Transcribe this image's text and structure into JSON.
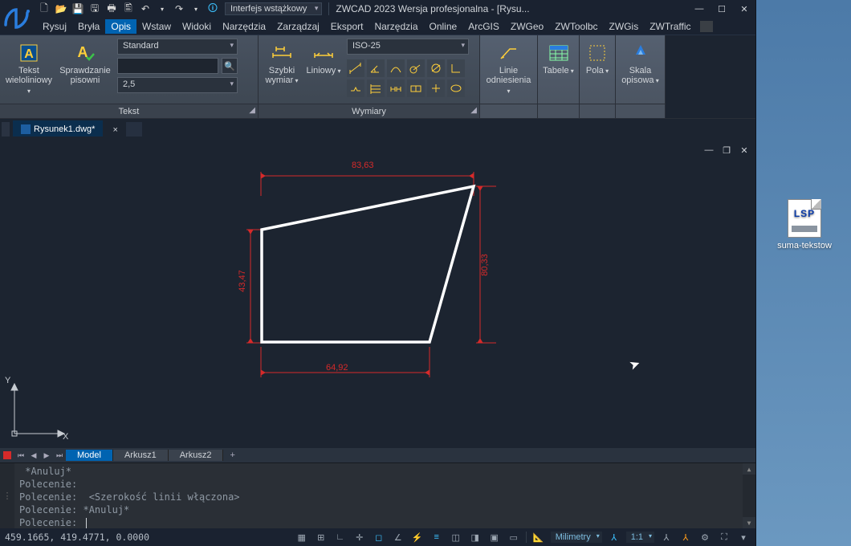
{
  "title": "ZWCAD 2023 Wersja profesjonalna - [Rysu...",
  "ribbon_mode": "Interfejs wstążkowy",
  "menus": [
    "Rysuj",
    "Bryła",
    "Opis",
    "Wstaw",
    "Widoki",
    "Narzędzia",
    "Zarządzaj",
    "Eksport",
    "Narzędzia",
    "Online",
    "ArcGIS",
    "ZWGeo",
    "ZWToolbc",
    "ZWGis",
    "ZWTraffic"
  ],
  "active_menu": 2,
  "ribbon": {
    "text_panel": {
      "caption": "Tekst",
      "mtext": "Tekst\nwieloliniowy",
      "spell": "Sprawdzanie\npisowni",
      "style": "Standard",
      "height": "2,5"
    },
    "dim_panel": {
      "caption": "Wymiary",
      "quick": "Szybki\nwymiar",
      "linear": "Liniowy",
      "style": "ISO-25"
    },
    "leaders": "Linie\nodniesienia",
    "tables": "Tabele",
    "fields": "Pola",
    "scale": "Skala\nopisowa"
  },
  "file_tab": "Rysunek1.dwg*",
  "sheet_tabs": {
    "model": "Model",
    "sheets": [
      "Arkusz1",
      "Arkusz2"
    ]
  },
  "dims": {
    "top": "83,63",
    "right": "80,33",
    "left": "43,47",
    "bottom": "64,92"
  },
  "ucs": {
    "x": "X",
    "y": "Y"
  },
  "cmd": {
    "l1": " *Anuluj*",
    "l2": "Polecenie:",
    "l3": "Polecenie:  <Szerokość linii włączona>",
    "l4": "Polecenie: *Anuluj*",
    "prompt": "Polecenie: "
  },
  "status": {
    "coords": "459.1665, 419.4771, 0.0000",
    "units": "Milimetry",
    "scale": "1:1"
  },
  "desktop_file": {
    "ext": "LSP",
    "name": "suma-tekstow"
  }
}
